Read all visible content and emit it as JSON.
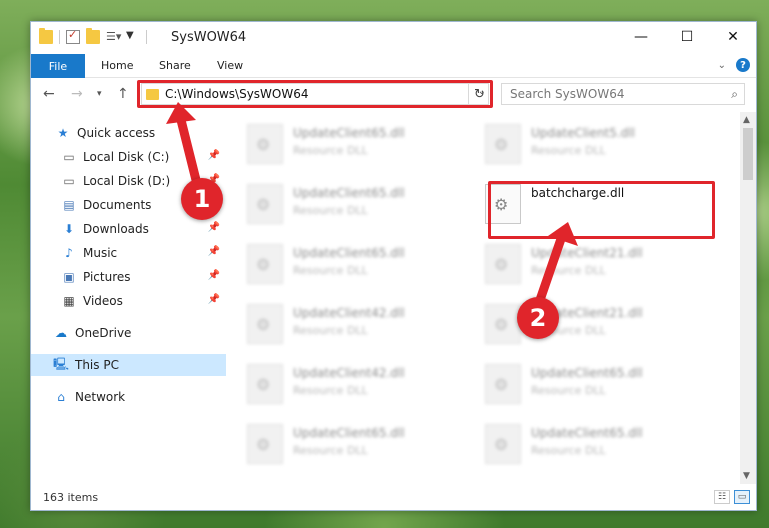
{
  "window": {
    "title": "SysWOW64",
    "minimize_icon": "minimize-icon",
    "maximize_icon": "maximize-icon",
    "close_icon": "close-icon"
  },
  "ribbon": {
    "tabs": [
      "File",
      "Home",
      "Share",
      "View"
    ],
    "accent": "#1979ca"
  },
  "address": {
    "path": "C:\\Windows\\SysWOW64",
    "search_placeholder": "Search SysWOW64"
  },
  "nav": {
    "items": [
      {
        "label": "Quick access",
        "icon": "star-icon"
      },
      {
        "label": "Local Disk (C:)",
        "icon": "drive-icon",
        "pinned": true
      },
      {
        "label": "Local Disk (D:)",
        "icon": "drive-icon",
        "pinned": true
      },
      {
        "label": "Documents",
        "icon": "documents-icon",
        "pinned": true
      },
      {
        "label": "Downloads",
        "icon": "download-icon",
        "pinned": true
      },
      {
        "label": "Music",
        "icon": "music-icon",
        "pinned": true
      },
      {
        "label": "Pictures",
        "icon": "pictures-icon",
        "pinned": true
      },
      {
        "label": "Videos",
        "icon": "videos-icon",
        "pinned": true
      },
      {
        "label": "OneDrive",
        "icon": "cloud-icon"
      },
      {
        "label": "This PC",
        "icon": "computer-icon",
        "selected": true
      },
      {
        "label": "Network",
        "icon": "network-icon"
      }
    ]
  },
  "files": [
    {
      "name": "UpdateClient65.dll",
      "type": "Resource DLL"
    },
    {
      "name": "UpdateClient5.dll",
      "type": "Resource DLL"
    },
    {
      "name": "UpdateClient65.dll",
      "type": "Resource DLL"
    },
    {
      "name": "batchcharge.dll",
      "type": ""
    },
    {
      "name": "UpdateClient65.dll",
      "type": "Resource DLL"
    },
    {
      "name": "UpdateClient21.dll",
      "type": "Resource DLL"
    },
    {
      "name": "UpdateClient42.dll",
      "type": "Resource DLL"
    },
    {
      "name": "UpdateClient21.dll",
      "type": "Resource DLL"
    },
    {
      "name": "UpdateClient42.dll",
      "type": "Resource DLL"
    },
    {
      "name": "UpdateClient65.dll",
      "type": "Resource DLL"
    },
    {
      "name": "UpdateClient65.dll",
      "type": "Resource DLL"
    },
    {
      "name": "UpdateClient65.dll",
      "type": "Resource DLL"
    }
  ],
  "status": {
    "item_count": "163 items"
  },
  "callouts": {
    "one": "1",
    "two": "2",
    "color": "#e0252b"
  }
}
